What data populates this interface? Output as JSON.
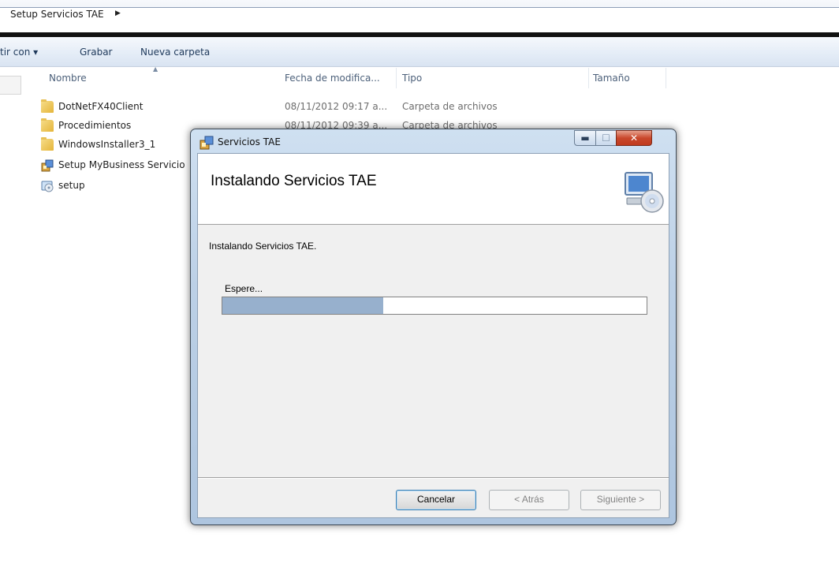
{
  "explorer": {
    "breadcrumb": "Setup Servicios TAE",
    "commands": [
      "tir con ▾",
      "Grabar",
      "Nueva carpeta"
    ],
    "columns": {
      "name": "Nombre",
      "date": "Fecha de modifica...",
      "type": "Tipo",
      "size": "Tamaño"
    },
    "files": [
      {
        "name": "DotNetFX40Client",
        "date": "08/11/2012 09:17 a...",
        "type": "Carpeta de archivos",
        "icon": "folder-icon"
      },
      {
        "name": "Procedimientos",
        "date": "08/11/2012 09:39 a...",
        "type": "Carpeta de archivos",
        "icon": "folder-icon"
      },
      {
        "name": "WindowsInstaller3_1",
        "date": "",
        "type": "",
        "icon": "folder-icon"
      },
      {
        "name": "Setup MyBusiness Servicio",
        "date": "",
        "type": "",
        "icon": "msi-package-icon"
      },
      {
        "name": "setup",
        "date": "",
        "type": "",
        "icon": "setup-exe-icon"
      }
    ]
  },
  "dialog": {
    "title": "Servicios TAE",
    "heading": "Instalando Servicios TAE",
    "message": "Instalando Servicios TAE.",
    "wait_label": "Espere...",
    "progress": 0.38,
    "buttons": {
      "cancel": "Cancelar",
      "back": "< Atrás",
      "next": "Siguiente >"
    },
    "window_controls": {
      "minimize": "minimize-icon",
      "maximize": "maximize-icon",
      "close": "close-icon"
    }
  },
  "colors": {
    "progress_fill": "#97b0cd",
    "close_button": "#c9482c",
    "link_text": "#1e395b"
  }
}
